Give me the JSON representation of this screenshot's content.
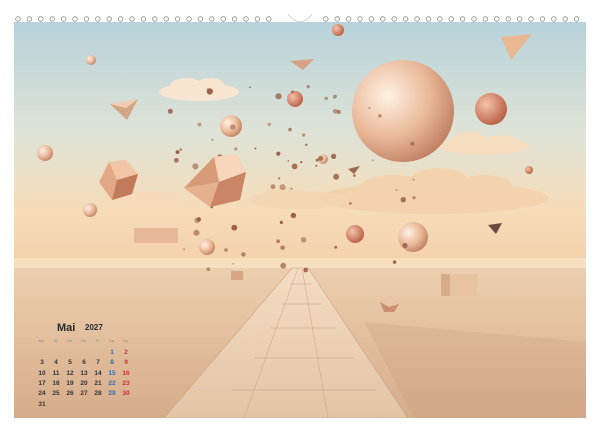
{
  "calendar": {
    "month": "Mai",
    "year": "2027",
    "weekdays": [
      "Mo",
      "Di",
      "Mi",
      "Do",
      "Fr",
      "Sa",
      "So"
    ],
    "weeks": [
      [
        "",
        "",
        "",
        "",
        "",
        "1",
        "2"
      ],
      [
        "3",
        "4",
        "5",
        "6",
        "7",
        "8",
        "9"
      ],
      [
        "10",
        "11",
        "12",
        "13",
        "14",
        "15",
        "16"
      ],
      [
        "17",
        "18",
        "19",
        "20",
        "21",
        "22",
        "23"
      ],
      [
        "24",
        "25",
        "26",
        "27",
        "28",
        "29",
        "30"
      ],
      [
        "31",
        "",
        "",
        "",
        "",
        "",
        ""
      ]
    ]
  },
  "colors": {
    "sky_top": "#b9d4dc",
    "sky_bottom": "#f5dcbc",
    "floor": "#e9c9a8",
    "sphere": "#e6b79a",
    "weekday_sat": "#2a6fb0",
    "weekday_sun": "#c83030"
  }
}
